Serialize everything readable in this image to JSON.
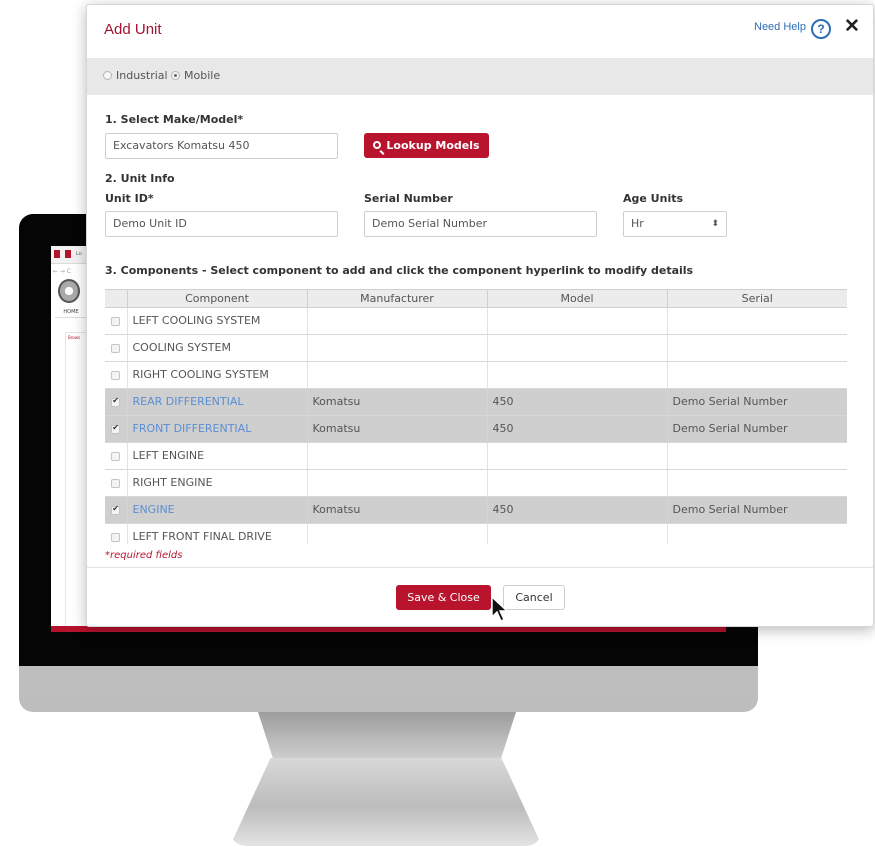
{
  "modal": {
    "title": "Add Unit",
    "help_label": "Need Help",
    "help_icon": "?",
    "close_icon": "✕"
  },
  "unit_type": {
    "options": [
      "Industrial",
      "Mobile"
    ],
    "selected": "Mobile"
  },
  "make_model": {
    "section_label": "1. Select Make/Model*",
    "value": "Excavators Komatsu 450",
    "lookup_button": "Lookup Models"
  },
  "unit_info": {
    "section_label": "2. Unit Info",
    "unit_id_label": "Unit ID*",
    "unit_id_value": "Demo Unit ID",
    "serial_label": "Serial Number",
    "serial_value": "Demo Serial Number",
    "age_units_label": "Age Units",
    "age_units_value": "Hr",
    "age_units_caret": "⬍"
  },
  "components": {
    "section_label": "3. Components  - Select component to add and click the component hyperlink to modify details",
    "columns": [
      "Component",
      "Manufacturer",
      "Model",
      "Serial"
    ],
    "rows": [
      {
        "checked": false,
        "component": "LEFT COOLING SYSTEM",
        "manufacturer": "",
        "model": "",
        "serial": ""
      },
      {
        "checked": false,
        "component": "COOLING SYSTEM",
        "manufacturer": "",
        "model": "",
        "serial": ""
      },
      {
        "checked": false,
        "component": "RIGHT COOLING SYSTEM",
        "manufacturer": "",
        "model": "",
        "serial": ""
      },
      {
        "checked": true,
        "component": "REAR DIFFERENTIAL",
        "manufacturer": "Komatsu",
        "model": "450",
        "serial": "Demo Serial Number"
      },
      {
        "checked": true,
        "component": "FRONT DIFFERENTIAL",
        "manufacturer": "Komatsu",
        "model": "450",
        "serial": "Demo Serial Number"
      },
      {
        "checked": false,
        "component": "LEFT ENGINE",
        "manufacturer": "",
        "model": "",
        "serial": ""
      },
      {
        "checked": false,
        "component": "RIGHT ENGINE",
        "manufacturer": "",
        "model": "",
        "serial": ""
      },
      {
        "checked": true,
        "component": "ENGINE",
        "manufacturer": "Komatsu",
        "model": "450",
        "serial": "Demo Serial Number"
      },
      {
        "checked": false,
        "component": "LEFT FRONT FINAL DRIVE",
        "manufacturer": "",
        "model": "",
        "serial": ""
      }
    ]
  },
  "required_note": "*required fields",
  "footer": {
    "save_label": "Save & Close",
    "cancel_label": "Cancel"
  },
  "background_screen": {
    "nav_item": "HOME",
    "side_text": "Brows"
  },
  "colors": {
    "accent": "#b8142e",
    "link": "#2e6eb4",
    "selected_row": "#cfcfcf",
    "selected_link": "#5b8ed2"
  }
}
